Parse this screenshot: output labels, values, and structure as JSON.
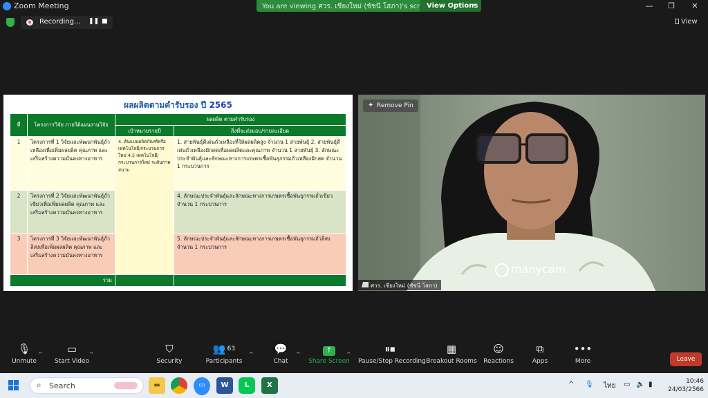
{
  "window": {
    "title": "Zoom Meeting",
    "controls": [
      "—",
      "❐",
      "✕"
    ]
  },
  "share_banner": {
    "message": "You are viewing ศวร. เชียงใหม่ (ชัชนี โสภา)'s screen",
    "options_label": "View Options",
    "chevron": "⌄"
  },
  "recording": {
    "label": "Recording...",
    "pause_glyph": "❚❚",
    "stop_glyph": "■"
  },
  "view_button": {
    "label": "View"
  },
  "slide": {
    "title_prefix": "ผลผลิตตามคำรับรอง ปี",
    "title_year": "2565",
    "headers": {
      "no": "ที่",
      "project": "โครงการวิจัย ภายใต้แผนงานวิจัย",
      "output": "ผลผลิต ตามคำรับรอง",
      "target": "เป้าหมายรายปี",
      "deliverable": "สิ่งที่จะส่งมอบ/รายละเอียด",
      "total": "รวม"
    },
    "target_text": "4. ต้นแบบผลิตภัณฑ์หรือ เทคโนโลยี/กระบวนการใหม่ 4.5 เทคโนโลยี/ กระบวนการใหม่ ระดับภาคสนาม",
    "rows": [
      {
        "no": "1",
        "project": "โครงการที่ 1 วิจัยและพัฒนาพันธุ์ถั่วเหลืองเพื่อเพิ่มผลผลิต คุณภาพ และเสริมสร้างความมั่นคงทางอาหาร",
        "deliverable": "1. สายพันธุ์ดีเด่นถั่วเหลืองที่ให้ผลผลิตสูง จำนวน 1 สายพันธุ์ 2. สายพันธุ์ดีเด่นถั่วเหลืองฝักสดเพื่อผลผลิตและคุณภาพ จำนวน 1 สายพันธุ์ 3. ลักษณะประจำพันธุ์และลักษณะทางการเกษตรเชื้อพันธุกรรมถั่วเหลืองฝักสด จำนวน 1 กระบวนการ"
      },
      {
        "no": "2",
        "project": "โครงการที่ 2 วิจัยและพัฒนาพันธุ์ถั่วเขียวเพื่อเพิ่มผลผลิต คุณภาพ และเสริมสร้างความมั่นคงทางอาหาร",
        "deliverable": "4. ลักษณะประจำพันธุ์และลักษณะทางการเกษตรเชื้อพันธุกรรมถั่วเขียว จำนวน 1 กระบวนการ"
      },
      {
        "no": "3",
        "project": "โครงการที่ 3 วิจัยและพัฒนาพันธุ์ถั่วลิสงเพื่อเพิ่มผลผลิต คุณภาพ และเสริมสร้างความมั่นคงทางอาหาร",
        "deliverable": "5. ลักษณะประจำพันธุ์และลักษณะทางการเกษตรเชื้อพันธุกรรมถั่วลิสง จำนวน 1 กระบวนการ"
      }
    ]
  },
  "video": {
    "remove_pin_label": "Remove Pin",
    "watermark": "manycam",
    "participant_name": "ศวร. เชียงใหม่ (ชัชนี โสภา)"
  },
  "controls": {
    "unmute": "Unmute",
    "start_video": "Start Video",
    "security": "Security",
    "participants": "Participants",
    "participants_count": "63",
    "chat": "Chat",
    "share_screen": "Share Screen",
    "pause_stop_recording": "Pause/Stop Recording",
    "breakout_rooms": "Breakout Rooms",
    "reactions": "Reactions",
    "apps": "Apps",
    "more": "More",
    "leave": "Leave"
  },
  "taskbar": {
    "search_placeholder": "Search",
    "language": "ไทย",
    "time": "10:46",
    "date": "24/03/2566",
    "apps": [
      "file-explorer",
      "chrome",
      "zoom",
      "word",
      "line",
      "excel"
    ]
  },
  "colors": {
    "banner_green": "#2e8b3e",
    "table_header_green": "#0b7a2a",
    "leave_red": "#c0392b",
    "share_screen_green": "#2eb14c",
    "slide_title_blue": "#1a5aa8"
  }
}
